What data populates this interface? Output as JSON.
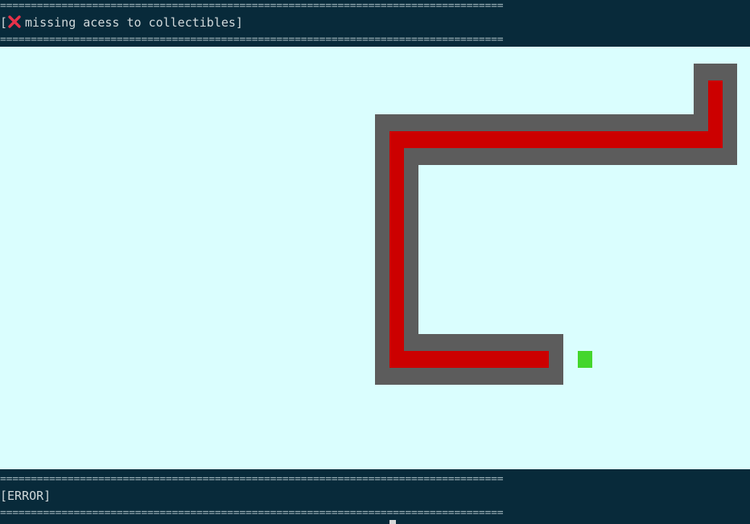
{
  "top_bar": {
    "rule": "==================================================================================",
    "status_open": "[",
    "status_icon": "cross-mark-icon",
    "status_text": "missing acess to collectibles]",
    "status_icon_color": "#e8324a"
  },
  "bottom_bar": {
    "rule": "==================================================================================",
    "status_text": "[ERROR]"
  },
  "colors": {
    "board_background": "#dafefe",
    "snake_body": "#cc0000",
    "snake_outline": "#5c5c5c",
    "collectible": "#44d62c",
    "terminal_background": "#082a3a"
  }
}
